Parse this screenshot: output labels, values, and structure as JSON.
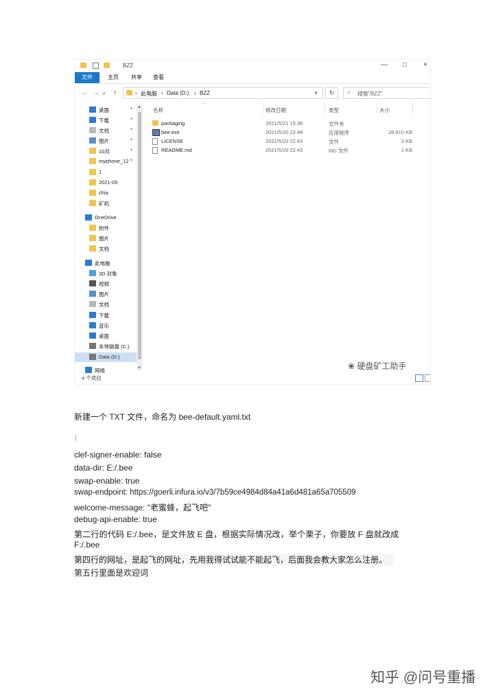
{
  "window": {
    "title": "BZZ",
    "ribbon_tabs": [
      "文件",
      "主页",
      "共享",
      "查看"
    ],
    "controls": [
      "—",
      "□",
      "×"
    ]
  },
  "address": {
    "segments": [
      "此电脑",
      "Data (D:)",
      "BZZ"
    ],
    "search_placeholder": "搜索\"BZZ\""
  },
  "nav_items": [
    {
      "label": "桌面",
      "icon": "desktop-icon",
      "pinned": true
    },
    {
      "label": "下载",
      "icon": "download-icon",
      "pinned": true
    },
    {
      "label": "文档",
      "icon": "document-icon",
      "pinned": true
    },
    {
      "label": "图片",
      "icon": "picture-icon",
      "pinned": true
    },
    {
      "label": "10月",
      "icon": "folder-icon",
      "pinned": true
    },
    {
      "label": "myphone_12",
      "icon": "folder-icon",
      "pinned": true
    },
    {
      "label": "1",
      "icon": "folder-icon",
      "pinned": false
    },
    {
      "label": "2021-05",
      "icon": "folder-icon",
      "pinned": false
    },
    {
      "label": "chia",
      "icon": "folder-icon",
      "pinned": false
    },
    {
      "label": "矿机",
      "icon": "folder-icon",
      "pinned": false
    },
    {
      "label": "OneDrive",
      "icon": "cloud-icon",
      "group": true
    },
    {
      "label": "附件",
      "icon": "folder-icon"
    },
    {
      "label": "图片",
      "icon": "folder-icon"
    },
    {
      "label": "文档",
      "icon": "folder-icon"
    },
    {
      "label": "此电脑",
      "icon": "computer-icon",
      "group": true
    },
    {
      "label": "3D 对象",
      "icon": "3d-object-icon"
    },
    {
      "label": "视频",
      "icon": "video-icon"
    },
    {
      "label": "图片",
      "icon": "picture-icon"
    },
    {
      "label": "文档",
      "icon": "document-icon"
    },
    {
      "label": "下载",
      "icon": "download-icon"
    },
    {
      "label": "音乐",
      "icon": "music-icon"
    },
    {
      "label": "桌面",
      "icon": "desktop-icon"
    },
    {
      "label": "本地磁盘 (C:)",
      "icon": "drive-icon"
    },
    {
      "label": "Data (D:)",
      "icon": "drive-icon",
      "selected": true
    },
    {
      "label": "网络",
      "icon": "network-icon",
      "group": true
    }
  ],
  "columns": {
    "name": "名称",
    "date": "修改日期",
    "type": "类型",
    "size": "大小"
  },
  "files": [
    {
      "name": "packaging",
      "date": "2021/5/21 15:38",
      "type": "文件夹",
      "size": "",
      "icon": "folder-icon"
    },
    {
      "name": "bee.exe",
      "date": "2021/5/20 22:48",
      "type": "应用程序",
      "size": "28,910 KB",
      "icon": "exe-icon"
    },
    {
      "name": "LICENSE",
      "date": "2021/5/20 22:43",
      "type": "文件",
      "size": "2 KB",
      "icon": "file-icon"
    },
    {
      "name": "README.md",
      "date": "2021/5/20 22:43",
      "type": "MD 文件",
      "size": "1 KB",
      "icon": "file-icon"
    }
  ],
  "status": "4 个项目",
  "watermark": "硬盘矿工助手",
  "article": {
    "intro": "新建一个 TXT 文件，命名为 bee-default.yaml.txt",
    "lines": [
      "clef-signer-enable: false",
      "data-dir: E:/.bee",
      "swap-enable: true",
      "swap-endpoint: https://goerli.infura.io/v3/7b59ce4984d84a41a6d481a65a705509",
      "welcome-message: \"老蜜蜂，起飞吧\"",
      "debug-api-enable: true"
    ],
    "note1a": "第二行的代码 E:/.bee，是文件放 E 盘，根据实际情况改，举个栗子，你要放 F 盘就改成",
    "note1b": "F:/.bee",
    "note2": "第四行的网址，是起飞的网址，先用我得试试能不能起飞，后面我会教大家怎么注册。",
    "note3": "第五行里面是欢迎词"
  },
  "footer_watermark": "知乎 @问号重播"
}
